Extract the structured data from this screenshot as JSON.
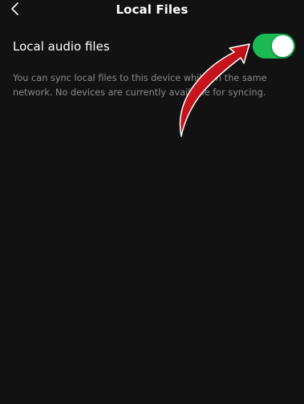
{
  "header": {
    "title": "Local Files"
  },
  "settings": {
    "local_audio": {
      "label": "Local audio files",
      "enabled": true
    },
    "description": "You can sync local files to this device while on the same network. No devices are currently available for syncing."
  },
  "colors": {
    "background": "#121212",
    "toggle_on": "#1db954",
    "arrow": "#c0111a"
  },
  "icons": {
    "back": "chevron-left-icon",
    "annotation": "red-arrow-icon"
  }
}
